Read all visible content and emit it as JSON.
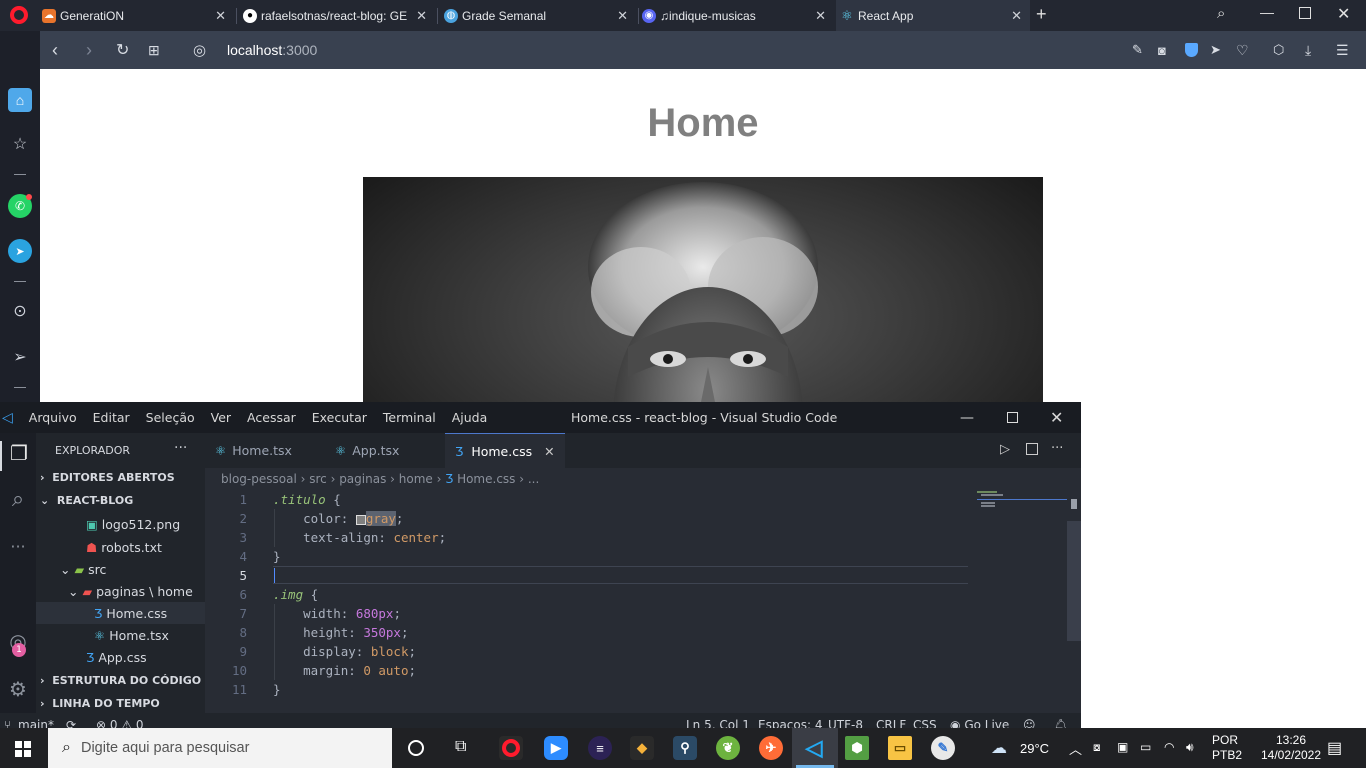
{
  "browser": {
    "tabs": [
      {
        "label": "GeneratiON",
        "icon": "cloud-orange-icon",
        "color": "#e8742c"
      },
      {
        "label": "rafaelsotnas/react-blog: GE",
        "icon": "github-icon",
        "color": "#ffffff"
      },
      {
        "label": "Grade Semanal",
        "icon": "globe-icon",
        "color": "#4aa3df"
      },
      {
        "label": "♫indique-musicas",
        "icon": "discord-icon",
        "color": "#5865f2"
      },
      {
        "label": "React App",
        "icon": "react-icon",
        "color": "#61dafb"
      }
    ],
    "url_host": "localhost",
    "url_port": ":3000"
  },
  "page": {
    "title": "Home"
  },
  "vscode": {
    "menu": [
      "Arquivo",
      "Editar",
      "Seleção",
      "Ver",
      "Acessar",
      "Executar",
      "Terminal",
      "Ajuda"
    ],
    "window_title": "Home.css - react-blog - Visual Studio Code",
    "explorer_title": "EXPLORADOR",
    "sections": {
      "open_editors": "EDITORES ABERTOS",
      "project": "REACT-BLOG",
      "outline": "ESTRUTURA DO CÓDIGO",
      "timeline": "LINHA DO TEMPO"
    },
    "tree": {
      "logo": "logo512.png",
      "robots": "robots.txt",
      "src": "src",
      "paginas": "paginas",
      "home": "home",
      "home_css": "Home.css",
      "home_tsx": "Home.tsx",
      "app_css": "App.css"
    },
    "tabs": [
      "Home.tsx",
      "App.tsx",
      "Home.css"
    ],
    "breadcrumb": [
      "blog-pessoal",
      "src",
      "paginas",
      "home",
      "Home.css",
      "..."
    ],
    "code": {
      "l1_sel": ".titulo",
      "l1_rest": " {",
      "l2_prop": "color",
      "l2_val": "gray",
      "l3_prop": "text-align",
      "l3_val": "center",
      "l4": "}",
      "l6_sel": ".img",
      "l6_rest": " {",
      "l7_prop": "width",
      "l7_val": "680px",
      "l8_prop": "height",
      "l8_val": "350px",
      "l9_prop": "display",
      "l9_val": "block",
      "l10_prop": "margin",
      "l10_val": "0 auto",
      "l11": "}"
    },
    "line_numbers": [
      "1",
      "2",
      "3",
      "4",
      "5",
      "6",
      "7",
      "8",
      "9",
      "10",
      "11"
    ],
    "status": {
      "branch": "main*",
      "problems_errors": "0",
      "problems_warnings": "0",
      "position": "Ln 5, Col 1",
      "spaces": "Espaços: 4",
      "encoding": "UTF-8",
      "eol": "CRLF",
      "language": "CSS",
      "golive": "Go Live"
    },
    "accounts_badge": "1"
  },
  "taskbar": {
    "search_placeholder": "Digite aqui para pesquisar",
    "weather": "29°C",
    "lang1": "POR",
    "lang2": "PTB2",
    "time": "13:26",
    "date": "14/02/2022"
  }
}
